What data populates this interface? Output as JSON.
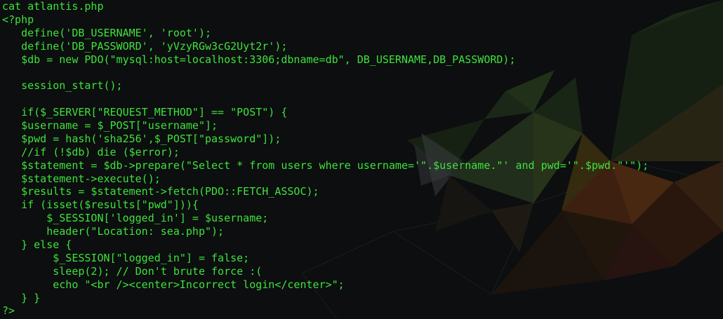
{
  "terminal": {
    "lines": [
      "cat atlantis.php",
      "<?php",
      "   define('DB_USERNAME', 'root');",
      "   define('DB_PASSWORD', 'yVzyRGw3cG2Uyt2r');",
      "   $db = new PDO(\"mysql:host=localhost:3306;dbname=db\", DB_USERNAME,DB_PASSWORD);",
      "",
      "   session_start();",
      "",
      "   if($_SERVER[\"REQUEST_METHOD\"] == \"POST\") {",
      "   $username = $_POST[\"username\"];",
      "   $pwd = hash('sha256',$_POST[\"password\"]);",
      "   //if (!$db) die ($error);",
      "   $statement = $db->prepare(\"Select * from users where username='\".$username.\"' and pwd='\".$pwd.\"'\");",
      "   $statement->execute();",
      "   $results = $statement->fetch(PDO::FETCH_ASSOC);",
      "   if (isset($results[\"pwd\"])){",
      "       $_SESSION['logged_in'] = $username;",
      "       header(\"Location: sea.php\");",
      "   } else {",
      "        $_SESSION[\"logged_in\"] = false;",
      "        sleep(2); // Don't brute force :(",
      "        echo \"<br /><center>Incorrect login</center>\";",
      "   } }",
      "?>"
    ]
  },
  "colors": {
    "text": "#3ee23b",
    "background": "#0d0e0f"
  },
  "icons": {
    "wallpaper": "low-poly-bird-wallpaper"
  }
}
